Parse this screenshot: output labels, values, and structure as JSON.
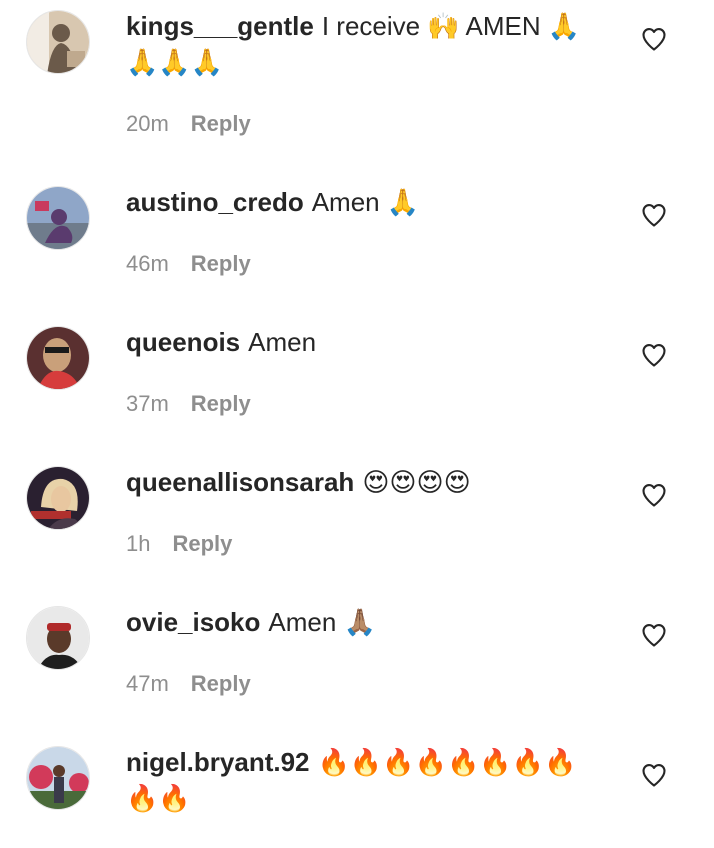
{
  "comments": [
    {
      "username": "kings___gentle",
      "text": "I receive 🙌 AMEN 🙏🙏🙏🙏",
      "time": "20m",
      "reply_label": "Reply",
      "avatar_colors": [
        "#d8c7b0",
        "#6b5a4a",
        "#f2ece4"
      ]
    },
    {
      "username": "austino_credo",
      "text": "Amen 🙏",
      "time": "46m",
      "reply_label": "Reply",
      "avatar_colors": [
        "#8fa6c8",
        "#5a3b6e",
        "#c93a5e"
      ]
    },
    {
      "username": "queenois",
      "text": "Amen",
      "time": "37m",
      "reply_label": "Reply",
      "avatar_colors": [
        "#5a3030",
        "#c9a07a",
        "#d63c3c"
      ]
    },
    {
      "username": "queenallisonsarah",
      "text": "😍😍😍😍",
      "time": "1h",
      "reply_label": "Reply",
      "avatar_colors": [
        "#2a2030",
        "#e8c7a0",
        "#b0302e"
      ]
    },
    {
      "username": "ovie_isoko",
      "text": "Amen 🙏🏽",
      "time": "47m",
      "reply_label": "Reply",
      "avatar_colors": [
        "#e9e9e9",
        "#5a3a2a",
        "#b02a2a"
      ]
    },
    {
      "username": "nigel.bryant.92",
      "text": "🔥🔥🔥🔥🔥🔥🔥🔥🔥🔥",
      "time": "",
      "reply_label": "",
      "avatar_colors": [
        "#c9d8e8",
        "#d23a5a",
        "#4a6a3a"
      ]
    }
  ]
}
